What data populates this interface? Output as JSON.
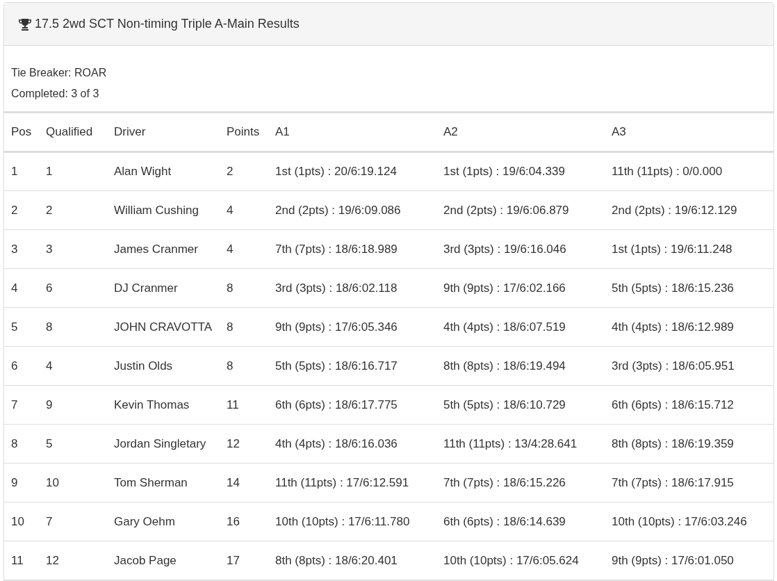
{
  "panel": {
    "title": "17.5 2wd SCT Non-timing Triple A-Main Results",
    "info": [
      "Tie Breaker: ROAR",
      "Completed: 3 of 3"
    ]
  },
  "table": {
    "columns": [
      "Pos",
      "Qualified",
      "Driver",
      "Points",
      "A1",
      "A2",
      "A3"
    ],
    "rows": [
      [
        "1",
        "1",
        "Alan Wight",
        "2",
        "1st (1pts) : 20/6:19.124",
        "1st (1pts) : 19/6:04.339",
        "11th (11pts) : 0/0.000"
      ],
      [
        "2",
        "2",
        "William Cushing",
        "4",
        "2nd (2pts) : 19/6:09.086",
        "2nd (2pts) : 19/6:06.879",
        "2nd (2pts) : 19/6:12.129"
      ],
      [
        "3",
        "3",
        "James Cranmer",
        "4",
        "7th (7pts) : 18/6:18.989",
        "3rd (3pts) : 19/6:16.046",
        "1st (1pts) : 19/6:11.248"
      ],
      [
        "4",
        "6",
        "DJ Cranmer",
        "8",
        "3rd (3pts) : 18/6:02.118",
        "9th (9pts) : 17/6:02.166",
        "5th (5pts) : 18/6:15.236"
      ],
      [
        "5",
        "8",
        "JOHN CRAVOTTA",
        "8",
        "9th (9pts) : 17/6:05.346",
        "4th (4pts) : 18/6:07.519",
        "4th (4pts) : 18/6:12.989"
      ],
      [
        "6",
        "4",
        "Justin Olds",
        "8",
        "5th (5pts) : 18/6:16.717",
        "8th (8pts) : 18/6:19.494",
        "3rd (3pts) : 18/6:05.951"
      ],
      [
        "7",
        "9",
        "Kevin Thomas",
        "11",
        "6th (6pts) : 18/6:17.775",
        "5th (5pts) : 18/6:10.729",
        "6th (6pts) : 18/6:15.712"
      ],
      [
        "8",
        "5",
        "Jordan Singletary",
        "12",
        "4th (4pts) : 18/6:16.036",
        "11th (11pts) : 13/4:28.641",
        "8th (8pts) : 18/6:19.359"
      ],
      [
        "9",
        "10",
        "Tom Sherman",
        "14",
        "11th (11pts) : 17/6:12.591",
        "7th (7pts) : 18/6:15.226",
        "7th (7pts) : 18/6:17.915"
      ],
      [
        "10",
        "7",
        "Gary Oehm",
        "16",
        "10th (10pts) : 17/6:11.780",
        "6th (6pts) : 18/6:14.639",
        "10th (10pts) : 17/6:03.246"
      ],
      [
        "11",
        "12",
        "Jacob Page",
        "17",
        "8th (8pts) : 18/6:20.401",
        "10th (10pts) : 17/6:05.624",
        "9th (9pts) : 17/6:01.050"
      ]
    ]
  }
}
